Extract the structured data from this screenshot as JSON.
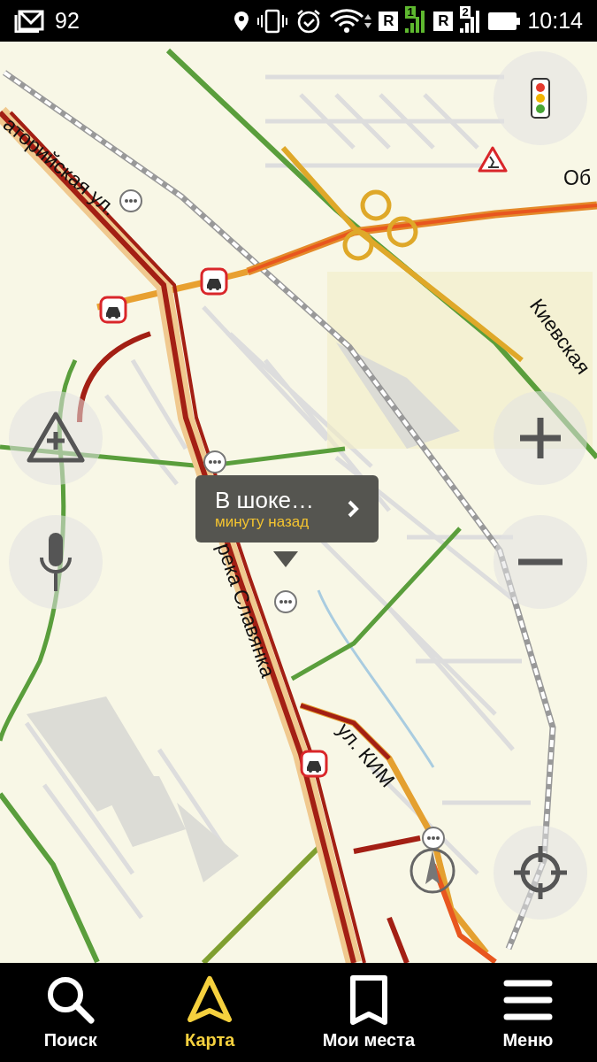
{
  "status_bar": {
    "notification_count": "92",
    "sim_1": {
      "roaming": "R",
      "slot": "1"
    },
    "sim_2": {
      "roaming": "R",
      "slot": "2"
    },
    "time": "10:14"
  },
  "map": {
    "street_labels": [
      "аторийская ул.",
      "Об",
      "Киевская",
      "река Славянка",
      "ул. КИМ"
    ],
    "popup": {
      "title": "В шоке…",
      "subtitle": "минуту назад"
    }
  },
  "nav": [
    {
      "label": "Поиск",
      "kind": "search",
      "selected": false
    },
    {
      "label": "Карта",
      "kind": "map",
      "selected": true
    },
    {
      "label": "Мои места",
      "kind": "bookmarks",
      "selected": false
    },
    {
      "label": "Меню",
      "kind": "menu",
      "selected": false
    }
  ]
}
